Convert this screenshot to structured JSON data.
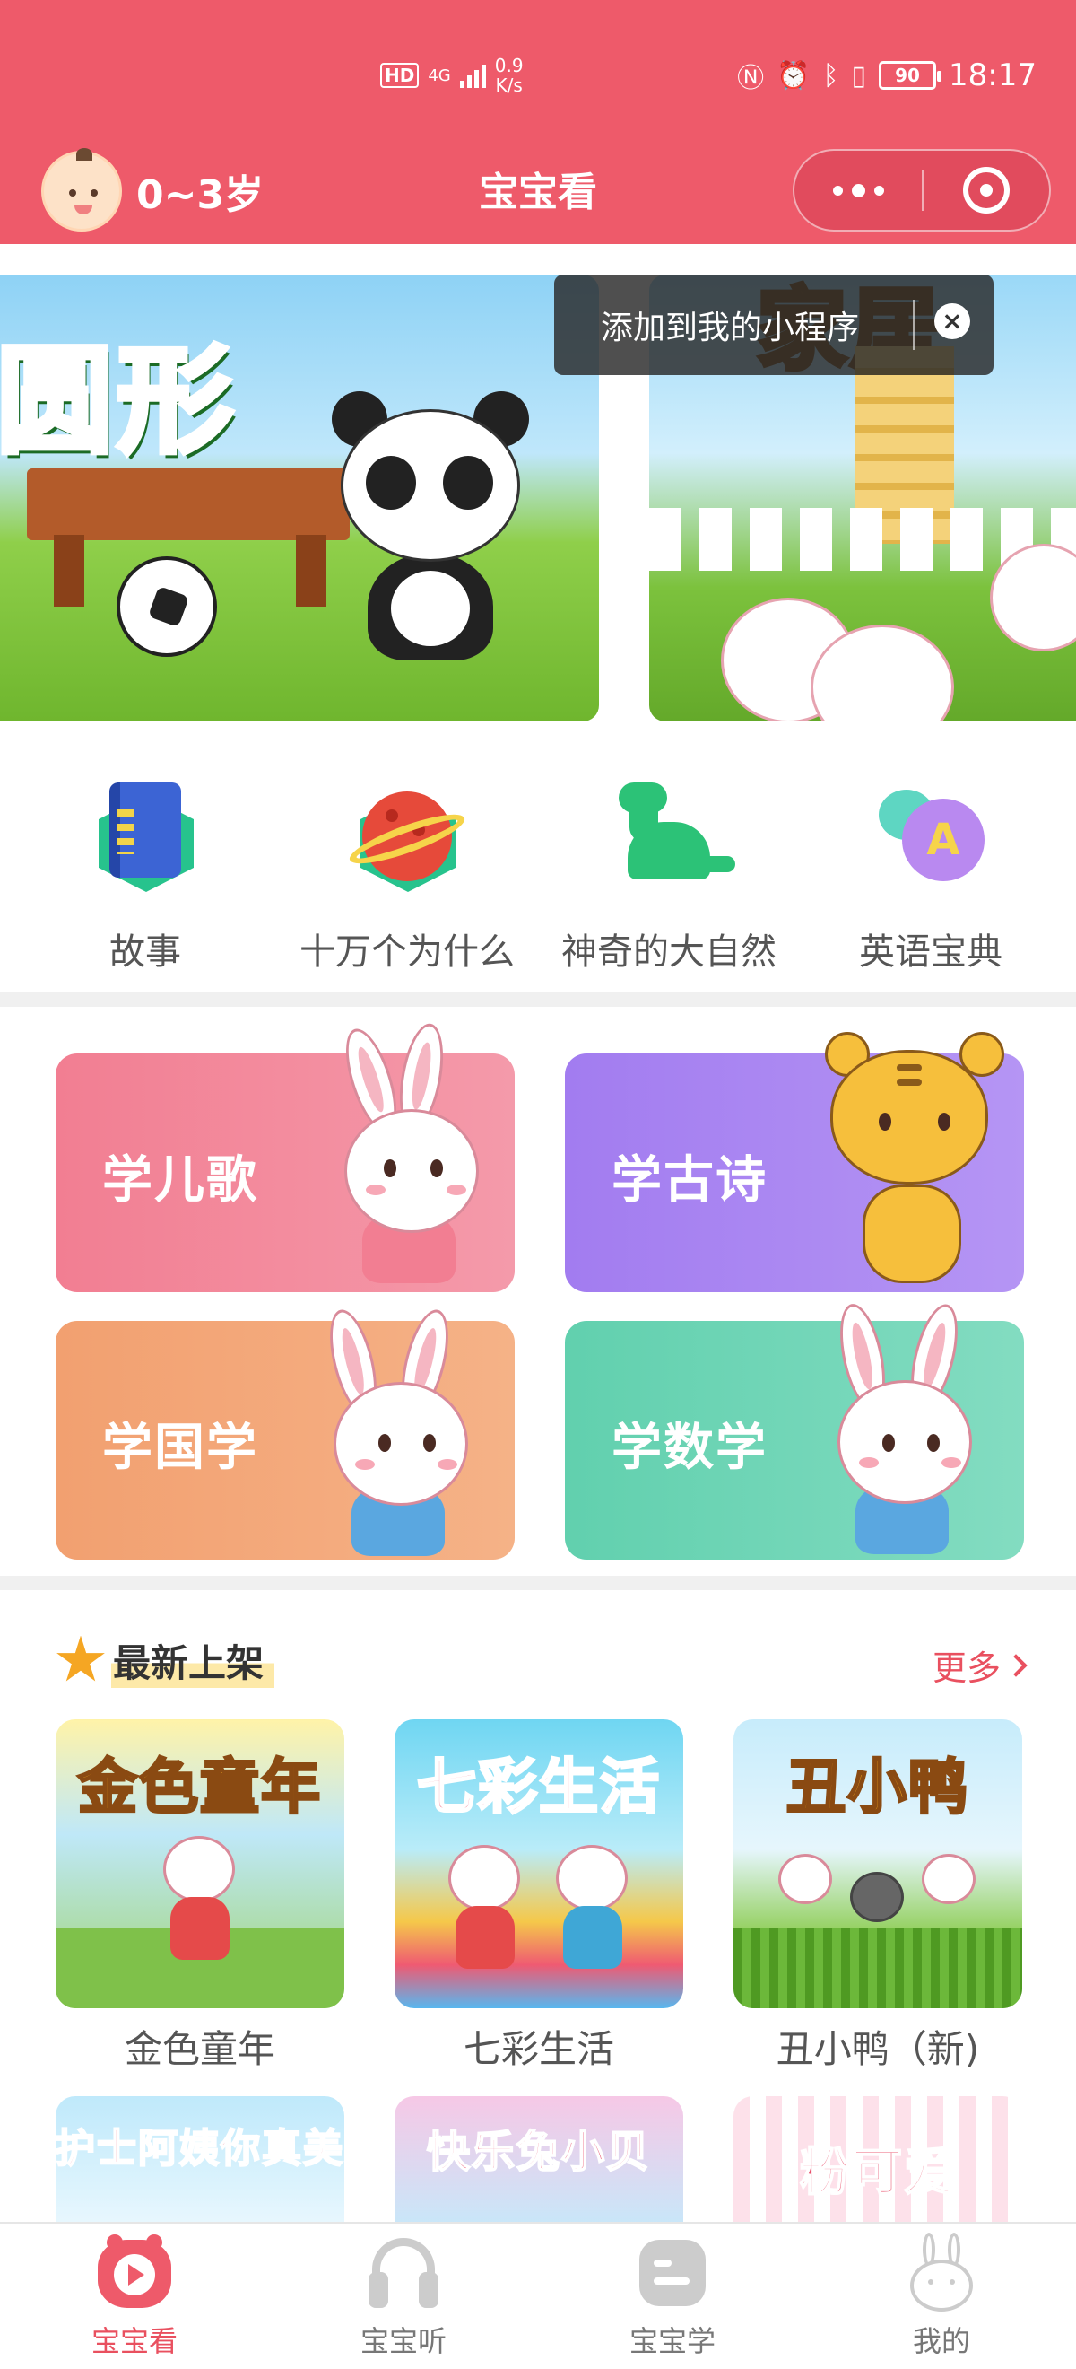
{
  "status_bar": {
    "network": "HD",
    "signal_gen": "4G",
    "speed_value": "0.9",
    "speed_unit": "K/s",
    "battery": "90",
    "time": "18:17"
  },
  "nav": {
    "age_label": "0~3岁",
    "title": "宝宝看"
  },
  "banner": {
    "slides": [
      {
        "title": "圆形"
      },
      {
        "title": "家居"
      }
    ]
  },
  "tooltip": {
    "text": "添加到我的小程序",
    "close_symbol": "×"
  },
  "quick_categories": [
    {
      "label": "故事",
      "icon": "book-icon"
    },
    {
      "label": "十万个为什么",
      "icon": "planet-icon"
    },
    {
      "label": "神奇的大自然",
      "icon": "dinosaur-icon"
    },
    {
      "label": "英语宝典",
      "icon": "english-bubble-icon",
      "glyph": "A"
    }
  ],
  "learn_cards": [
    {
      "label": "学儿歌",
      "color": "#f27e92"
    },
    {
      "label": "学古诗",
      "color": "#a27cf0"
    },
    {
      "label": "学国学",
      "color": "#f2a070"
    },
    {
      "label": "学数学",
      "color": "#61d0ae"
    }
  ],
  "newest": {
    "title": "最新上架",
    "more": "更多",
    "albums": [
      {
        "name": "金色童年",
        "cover_text": "金色童年"
      },
      {
        "name": "七彩生活",
        "cover_text": "七彩生活"
      },
      {
        "name": "丑小鸭（新)",
        "cover_text": "丑小鸭"
      },
      {
        "name": "",
        "cover_text": "护士阿姨你真美"
      },
      {
        "name": "",
        "cover_text": "快乐兔小贝"
      },
      {
        "name": "",
        "cover_text": "粉可爱"
      }
    ]
  },
  "tabbar": {
    "tabs": [
      {
        "label": "宝宝看",
        "icon": "play-icon",
        "active": true
      },
      {
        "label": "宝宝听",
        "icon": "headphones-icon",
        "active": false
      },
      {
        "label": "宝宝学",
        "icon": "learn-icon",
        "active": false
      },
      {
        "label": "我的",
        "icon": "rabbit-profile-icon",
        "active": false
      }
    ]
  },
  "colors": {
    "brand": "#ee5a6a",
    "accent": "#e9505f"
  }
}
